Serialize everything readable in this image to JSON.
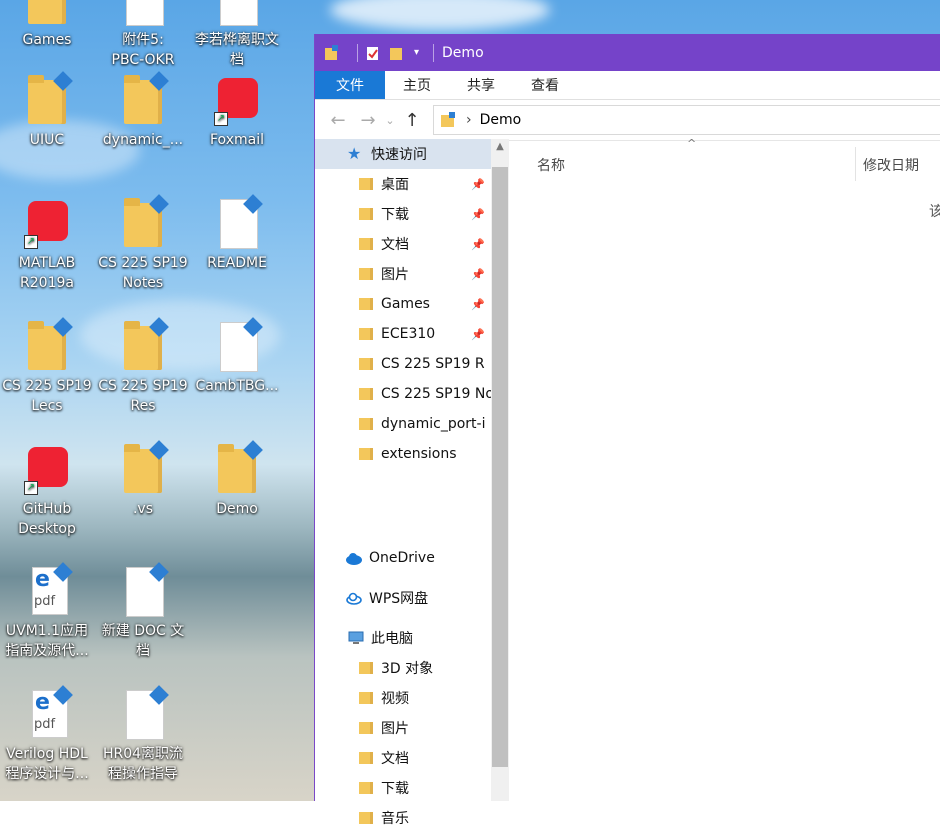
{
  "desktop": {
    "icons": [
      {
        "label": "Games",
        "label2": "",
        "type": "folder"
      },
      {
        "label": "附件5:",
        "label2": "PBC-OKR",
        "type": "doc"
      },
      {
        "label": "李若桦离职文",
        "label2": "档",
        "type": "doc"
      },
      {
        "label": "UIUC",
        "label2": "",
        "type": "folder"
      },
      {
        "label": "dynamic_...",
        "label2": "",
        "type": "folder"
      },
      {
        "label": "Foxmail",
        "label2": "",
        "type": "app"
      },
      {
        "label": "MATLAB",
        "label2": "R2019a",
        "type": "app"
      },
      {
        "label": "CS 225 SP19",
        "label2": "Notes",
        "type": "folder"
      },
      {
        "label": "README",
        "label2": "",
        "type": "doc"
      },
      {
        "label": "CS 225 SP19",
        "label2": "Lecs",
        "type": "folder"
      },
      {
        "label": "CS 225 SP19",
        "label2": "Res",
        "type": "folder"
      },
      {
        "label": "CambTBG...",
        "label2": "",
        "type": "doc"
      },
      {
        "label": "GitHub",
        "label2": "Desktop",
        "type": "app"
      },
      {
        "label": ".vs",
        "label2": "",
        "type": "folder"
      },
      {
        "label": "Demo",
        "label2": "",
        "type": "folder"
      },
      {
        "label": "UVM1.1应用",
        "label2": "指南及源代...",
        "type": "pdf"
      },
      {
        "label": "新建 DOC 文",
        "label2": "档",
        "type": "doc"
      },
      {
        "label": "Verilog HDL",
        "label2": "程序设计与...",
        "type": "pdf"
      },
      {
        "label": "HR04离职流",
        "label2": "程操作指导",
        "type": "doc"
      }
    ]
  },
  "window": {
    "title": "Demo",
    "ribbon_tabs": [
      "文件",
      "主页",
      "共享",
      "查看"
    ],
    "address": {
      "crumb": "Demo"
    },
    "nav": {
      "quick_access": "快速访问",
      "pinned": [
        "桌面",
        "下载",
        "文档",
        "图片",
        "Games",
        "ECE310"
      ],
      "recent": [
        "CS 225 SP19  R",
        "CS 225 SP19 No",
        "dynamic_port-i",
        "extensions"
      ],
      "onedrive": "OneDrive",
      "wps": "WPS网盘",
      "thispc": "此电脑",
      "pc_items": [
        "3D 对象",
        "视频",
        "图片",
        "文档",
        "下载",
        "音乐"
      ]
    },
    "columns": {
      "name": "名称",
      "modified": "修改日期",
      "overflow": "该"
    },
    "colors": {
      "titlebar": "#7543c9",
      "active_tab": "#1a79d6"
    }
  }
}
